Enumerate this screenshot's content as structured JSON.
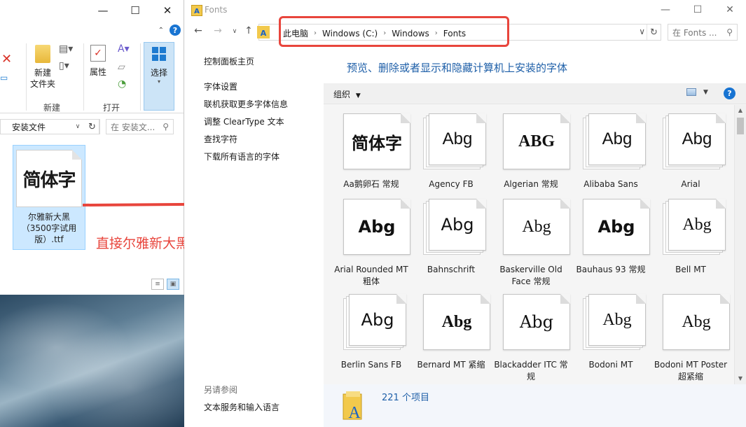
{
  "left_window": {
    "ribbon": {
      "new_folder_label": "新建\n文件夹",
      "new_group": "新建",
      "properties_label": "属性",
      "open_group": "打开",
      "select_label": "选择"
    },
    "address": "安装文件",
    "search_placeholder": "在 安装文...",
    "file": {
      "thumb_sample": "简体字",
      "name": "尔雅新大黑（3500字试用版）.ttf"
    }
  },
  "annotation": {
    "text": "直接尔雅新大黑字体复制过来",
    "color": "#e8453c"
  },
  "fonts_window": {
    "title": "Fonts",
    "breadcrumbs": [
      "此电脑",
      "Windows (C:)",
      "Windows",
      "Fonts"
    ],
    "search_placeholder": "在 Fonts ...",
    "task_pane": {
      "links": [
        "控制面板主页",
        "字体设置",
        "联机获取更多字体信息",
        "调整 ClearType 文本",
        "查找字符",
        "下载所有语言的字体"
      ],
      "see_also_heading": "另请参阅",
      "see_also_links": [
        "文本服务和输入语言"
      ]
    },
    "main_title": "预览、删除或者显示和隐藏计算机上安装的字体",
    "toolbar": {
      "organize": "组织"
    },
    "fonts": [
      {
        "sample": "简体字",
        "name": "Aa鹅卵石 常规",
        "family": "\"DejaVu Sans\", sans-serif",
        "weight": "bold",
        "stacked": false
      },
      {
        "sample": "Abg",
        "name": "Agency FB",
        "family": "\"Liberation Sans\", sans-serif",
        "weight": "normal",
        "stacked": true
      },
      {
        "sample": "ABG",
        "name": "Algerian 常规",
        "family": "\"Liberation Serif\", serif",
        "weight": "bold",
        "stacked": false
      },
      {
        "sample": "Abg",
        "name": "Alibaba Sans",
        "family": "\"Liberation Sans\", sans-serif",
        "weight": "normal",
        "stacked": true
      },
      {
        "sample": "Abg",
        "name": "Arial",
        "family": "\"Liberation Sans\", sans-serif",
        "weight": "normal",
        "stacked": true
      },
      {
        "sample": "Abg",
        "name": "Arial Rounded MT 粗体",
        "family": "\"DejaVu Sans\", sans-serif",
        "weight": "bold",
        "stacked": false
      },
      {
        "sample": "Abg",
        "name": "Bahnschrift",
        "family": "\"DejaVu Sans\", sans-serif",
        "weight": "normal",
        "stacked": true
      },
      {
        "sample": "Abg",
        "name": "Baskerville Old Face 常规",
        "family": "\"Liberation Serif\", serif",
        "weight": "normal",
        "stacked": false
      },
      {
        "sample": "Abg",
        "name": "Bauhaus 93 常规",
        "family": "\"DejaVu Sans\", sans-serif",
        "weight": "bold",
        "stacked": false
      },
      {
        "sample": "Abg",
        "name": "Bell MT",
        "family": "\"Liberation Serif\", serif",
        "weight": "normal",
        "stacked": true
      },
      {
        "sample": "Abg",
        "name": "Berlin Sans FB",
        "family": "\"DejaVu Sans\", sans-serif",
        "weight": "normal",
        "stacked": true
      },
      {
        "sample": "Abg",
        "name": "Bernard MT 紧缩",
        "family": "\"Liberation Serif\", serif",
        "weight": "bold",
        "stacked": false
      },
      {
        "sample": "Abg",
        "name": "Blackadder ITC 常规",
        "family": "\"DejaVu Serif\", serif",
        "weight": "normal",
        "stacked": false
      },
      {
        "sample": "Abg",
        "name": "Bodoni MT",
        "family": "\"Liberation Serif\", serif",
        "weight": "normal",
        "stacked": true
      },
      {
        "sample": "Abg",
        "name": "Bodoni MT Poster 超紧缩",
        "family": "\"Liberation Serif\", serif",
        "weight": "normal",
        "stacked": false
      }
    ],
    "status": {
      "count": "221 个项目"
    }
  }
}
